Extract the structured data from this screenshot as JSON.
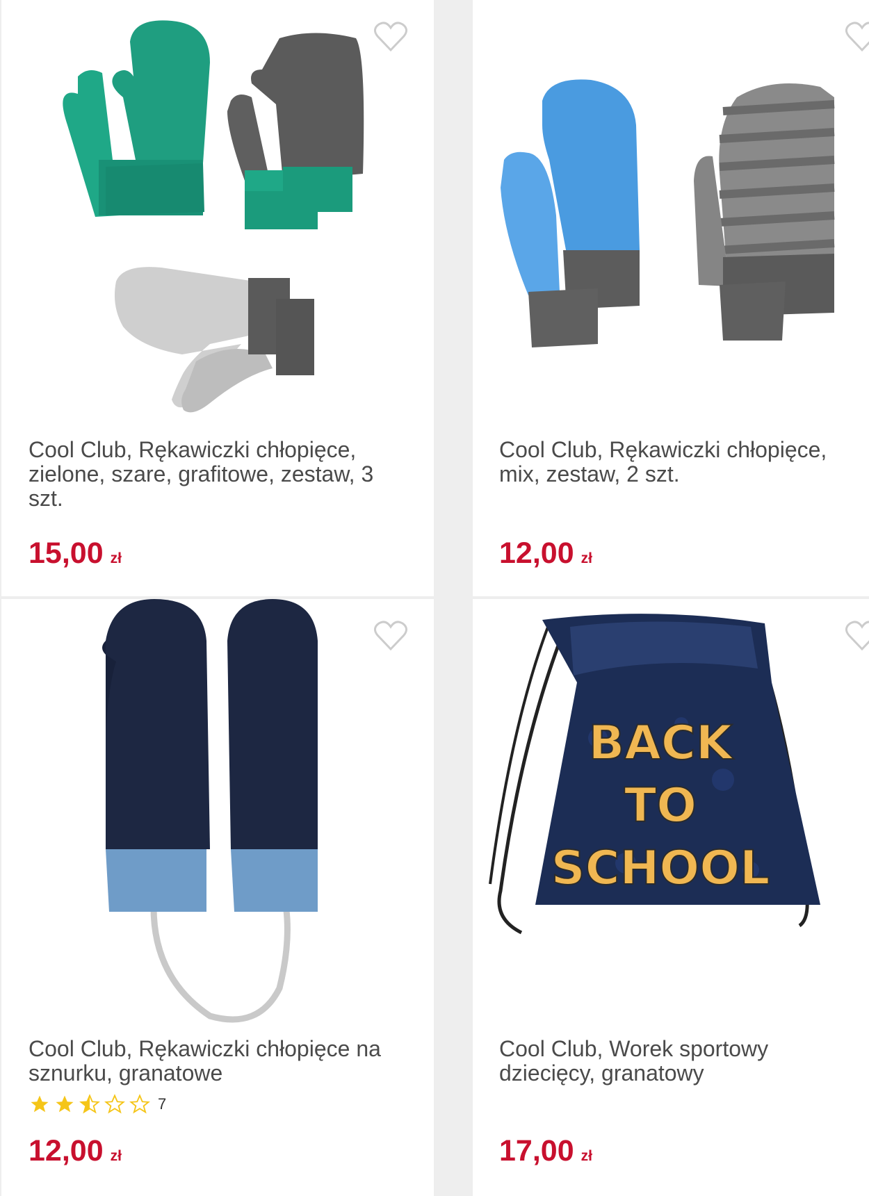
{
  "products": [
    {
      "title": "Cool Club, Rękawiczki chłopięce, zielone, szare, grafitowe, zestaw, 3 szt.",
      "price": "15,00",
      "currency": "zł",
      "favorite_icon": "heart-outline-icon"
    },
    {
      "title": "Cool Club, Rękawiczki chłopięce, mix, zestaw, 2 szt.",
      "price": "12,00",
      "currency": "zł",
      "favorite_icon": "heart-outline-icon"
    },
    {
      "title": "Cool Club, Rękawiczki chłopięce na sznurku, granatowe",
      "price": "12,00",
      "currency": "zł",
      "rating": 2.5,
      "rating_max": 5,
      "rating_count": "7",
      "favorite_icon": "heart-outline-icon"
    },
    {
      "title": "Cool Club, Worek sportowy dziecięcy, granatowy",
      "price": "17,00",
      "currency": "zł",
      "bag_print": [
        "BACK",
        "TO",
        "SCHOOL"
      ],
      "favorite_icon": "heart-outline-icon"
    }
  ],
  "colors": {
    "price": "#c8102e",
    "star": "#f5c518",
    "heart": "#cccccc"
  }
}
